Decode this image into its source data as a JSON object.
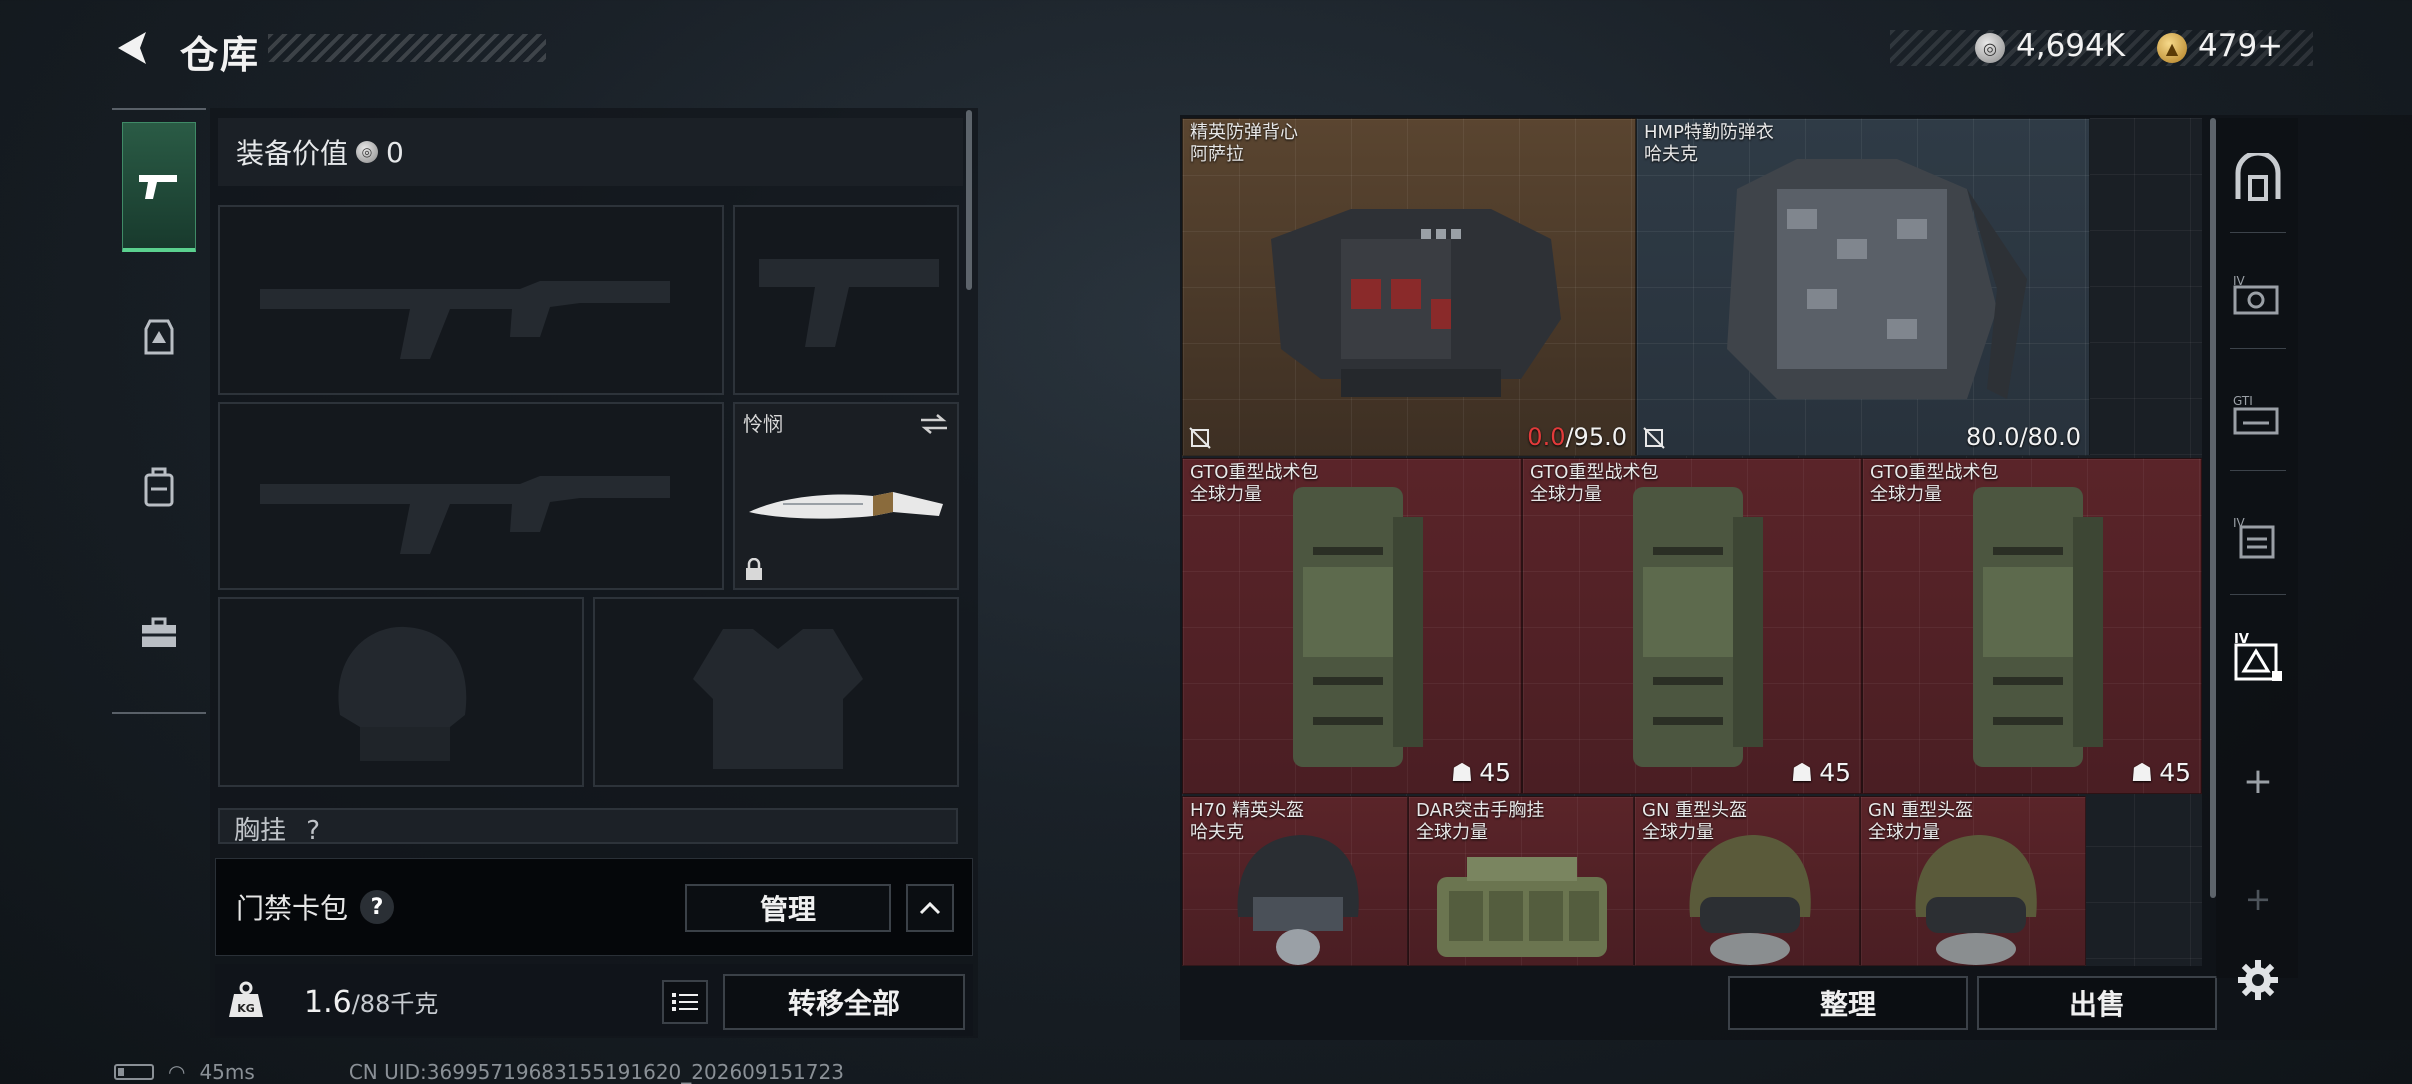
{
  "header": {
    "title": "仓库",
    "currencies": [
      {
        "icon": "silver-coin-icon",
        "value": "4,694K"
      },
      {
        "icon": "gold-coin-icon",
        "value": "479+"
      }
    ],
    "topup_symbol": "",
    "tiny_text": "▪▪▪ ▪▪"
  },
  "categories": [
    {
      "name": "weapon",
      "icon": "pistol-icon",
      "active": true
    },
    {
      "name": "equipment",
      "icon": "armor-plate-icon",
      "active": false
    },
    {
      "name": "backpack",
      "icon": "backpack-icon",
      "active": false
    },
    {
      "name": "case",
      "icon": "toolbox-icon",
      "active": false
    }
  ],
  "loadout": {
    "value_label": "装备价值",
    "value_amount": "0",
    "melee": {
      "name": "怜悯"
    },
    "chest_label": "胸挂",
    "chest_hint": "?"
  },
  "keycard": {
    "label": "门禁卡包",
    "help": "?",
    "manage": "管理"
  },
  "weight": {
    "current": "1.6",
    "max": "/88",
    "unit": "千克",
    "transfer": "转移全部"
  },
  "storage": {
    "items": [
      {
        "line1": "精英防弹背心",
        "line2": "阿萨拉",
        "dura_cur": "0.0",
        "dura_max": "/95.0",
        "color": "brown"
      },
      {
        "line1": "HMP特勤防弹衣",
        "line2": "哈夫克",
        "dura_cur": "80.0",
        "dura_max": "/80.0",
        "color": "grey"
      },
      {
        "line1": "GTO重型战术包",
        "line2": "全球力量",
        "capacity": "45",
        "color": "red"
      },
      {
        "line1": "GTO重型战术包",
        "line2": "全球力量",
        "capacity": "45",
        "color": "red"
      },
      {
        "line1": "GTO重型战术包",
        "line2": "全球力量",
        "capacity": "45",
        "color": "red"
      },
      {
        "line1": "H70 精英头盔",
        "line2": "哈夫克",
        "color": "red"
      },
      {
        "line1": "DAR突击手胸挂",
        "line2": "全球力量",
        "color": "red"
      },
      {
        "line1": "GN 重型头盔",
        "line2": "全球力量",
        "color": "red"
      },
      {
        "line1": "GN 重型头盔",
        "line2": "全球力量",
        "color": "red"
      }
    ],
    "sort": "整理",
    "sell": "出售"
  },
  "filters": [
    {
      "icon": "safebox-icon"
    },
    {
      "icon": "armor-iv-icon"
    },
    {
      "icon": "gti-icon"
    },
    {
      "icon": "backpack-iv-icon"
    },
    {
      "icon": "helmet-iv-icon",
      "active": true
    },
    {
      "icon": "add-icon"
    },
    {
      "icon": "add-icon-disabled"
    }
  ],
  "status": {
    "ping": "45ms",
    "uid": "CN UID:36995719683155191620_202609151723"
  },
  "colors": {
    "accent_green": "#5bd18f",
    "durability_low": "#e23a3a",
    "item_red": "#5a2429",
    "item_brown": "#58432e"
  }
}
